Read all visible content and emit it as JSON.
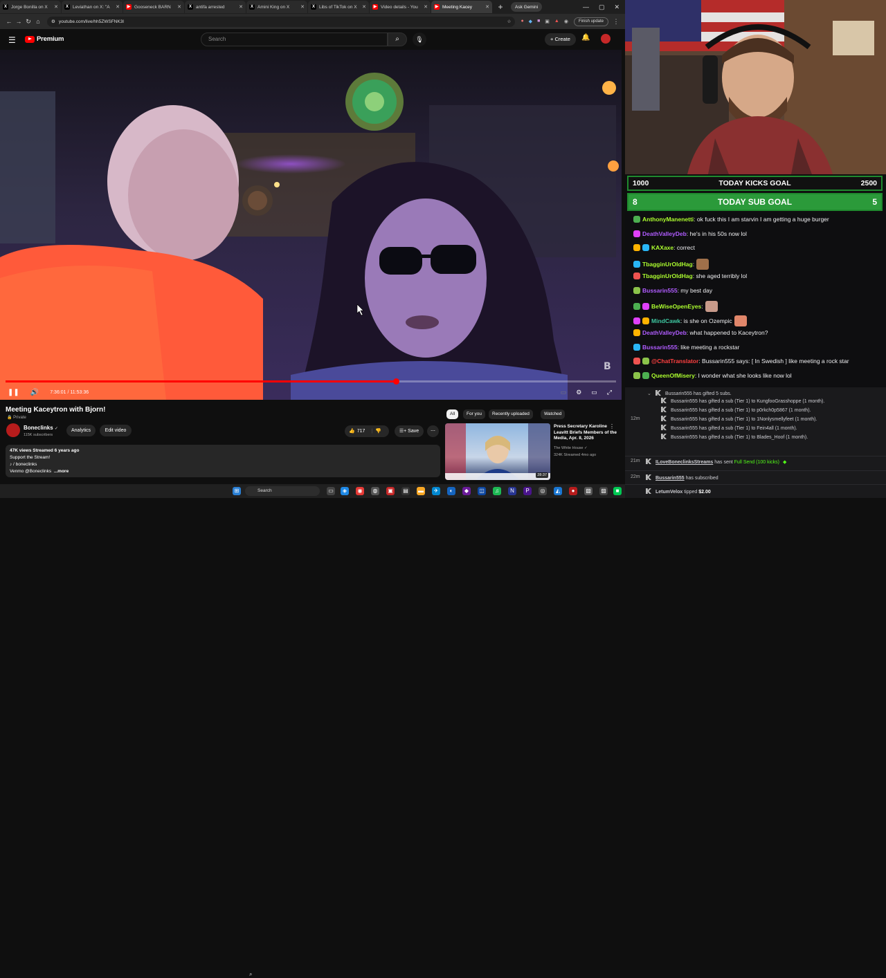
{
  "browser": {
    "tabs": [
      {
        "title": "Jorge Bonilla on X",
        "fav": "X",
        "fav_color": "#000000"
      },
      {
        "title": "Leviathan on X: \"A",
        "fav": "X",
        "fav_color": "#000000"
      },
      {
        "title": "Gooseneck BARN",
        "fav": "▶",
        "fav_color": "#ff0000"
      },
      {
        "title": "antifa arrested",
        "fav": "X",
        "fav_color": "#000000"
      },
      {
        "title": "Amini King on X",
        "fav": "X",
        "fav_color": "#000000"
      },
      {
        "title": "Libs of TikTok on X",
        "fav": "X",
        "fav_color": "#000000"
      },
      {
        "title": "Video details - You",
        "fav": "▶",
        "fav_color": "#ff0000"
      },
      {
        "title": "Meeting Kacey",
        "fav": "▶",
        "fav_color": "#ff0000"
      }
    ],
    "new_tab": "+",
    "ask_gemini": "Ask Gemini",
    "url": "youtube.com/live/hh5ZWSFNK3I",
    "finish_update": "Finish update"
  },
  "youtube": {
    "logo_text": "Premium",
    "search_placeholder": "Search",
    "create_label": "+ Create",
    "player": {
      "time_current": "7:36:01",
      "time_total": "11:53:36",
      "progress_fraction": 0.639
    },
    "video": {
      "title": "Meeting Kaceytron with Bjorn!",
      "privacy": "🔒 Private",
      "channel_name": "Boneclinks",
      "subscribers": "115K subscribers",
      "analytics_label": "Analytics",
      "edit_video_label": "Edit video",
      "likes": "717",
      "save_label": "Save",
      "desc_meta": "47K views  Streamed 6 years ago",
      "desc_line1": "Support the Stream!",
      "desc_line2": "♪ / boneclinks",
      "desc_line3": "Venmo @Boneclinks",
      "desc_more": "...more"
    },
    "chips": [
      "All",
      "For you",
      "Recently uploaded",
      "Watched"
    ],
    "recommendation": {
      "title": "Press Secretary Karoline Leavitt Briefs Members of the Media, Apr. 8, 2026",
      "channel": "The White House ✓",
      "meta": "324K  Streamed 4mo ago",
      "duration": "28:37"
    }
  },
  "taskbar": {
    "search_label": "Search"
  },
  "overlay": {
    "kicks_goal": {
      "left": "1000",
      "label": "TODAY KICKS GOAL",
      "right": "2500"
    },
    "sub_goal": {
      "left": "8",
      "label": "TODAY SUB GOAL",
      "right": "5"
    },
    "chat": [
      {
        "user": "AnthonyManenetti",
        "color": "#adff2f",
        "text": ": ok fuck this I am starvin I am getting a huge burger",
        "emote": ""
      },
      {
        "user": "DeathValleyDeb",
        "color": "#b05cff",
        "text": ": he's in his 50s now lol",
        "emote": ""
      },
      {
        "user": "KAXaxe",
        "color": "#adff2f",
        "text": ": correct",
        "emote": ""
      },
      {
        "user": "TbagginUrOldHag",
        "color": "#adff2f",
        "text": ":",
        "emote": "#a0704a"
      },
      {
        "user": "TbagginUrOldHag",
        "color": "#adff2f",
        "text": ": she aged terribly lol",
        "emote": ""
      },
      {
        "user": "Bussarin555",
        "color": "#b05cff",
        "text": ": my best day",
        "emote": ""
      },
      {
        "user": "BeWiseOpenEyes",
        "color": "#adff2f",
        "text": ":",
        "emote": "#c89a8a"
      },
      {
        "user": "MindCawk",
        "color": "#3ec7a0",
        "text": ": is she on Ozempic",
        "emote": "#e0866a"
      },
      {
        "user": "DeathValleyDeb",
        "color": "#b05cff",
        "text": ": what happened to Kaceytron?",
        "emote": ""
      },
      {
        "user": "Bussarin555",
        "color": "#b05cff",
        "text": ": like meeting a rockstar",
        "emote": ""
      },
      {
        "user": "@ChatTranslator",
        "color": "#ff4040",
        "text": ": Bussarin555 says: [ In Swedish ] like meeting a rock star",
        "emote": ""
      },
      {
        "user": "QueenOfMisery",
        "color": "#adff2f",
        "text": ": I wonder what she looks like now lol",
        "emote": ""
      }
    ],
    "events": {
      "gift_header": "Bussarin555 has gifted 5 subs.",
      "gift_time": "12m",
      "gifts": [
        {
          "user": "Bussarin555",
          "text": " has gifted a sub (Tier 1) to KungfooGrasshoppe (1 month)."
        },
        {
          "user": "Bussarin555",
          "text": " has gifted a sub (Tier 1) to p0rkch0p5867 (1 month)."
        },
        {
          "user": "Bussarin555",
          "text": " has gifted a sub (Tier 1) to 1Nonlysmellyfeet (1 month)."
        },
        {
          "user": "Bussarin555",
          "text": " has gifted a sub (Tier 1) to Fein4all (1 month)."
        },
        {
          "user": "Bussarin555",
          "text": " has gifted a sub (Tier 1) to Blades_Hoof (1 month)."
        }
      ],
      "send_time": "21m",
      "send_user": "ILoveBoneclinksStreams",
      "send_text": " has sent ",
      "send_amount": "Full Send (100 kicks)",
      "sub_time": "22m",
      "sub_user": "Bussarin555",
      "sub_text": " has subscribed",
      "tip_user": "LetumVelox",
      "tip_text": " tipped ",
      "tip_amount": "$2.00"
    }
  }
}
